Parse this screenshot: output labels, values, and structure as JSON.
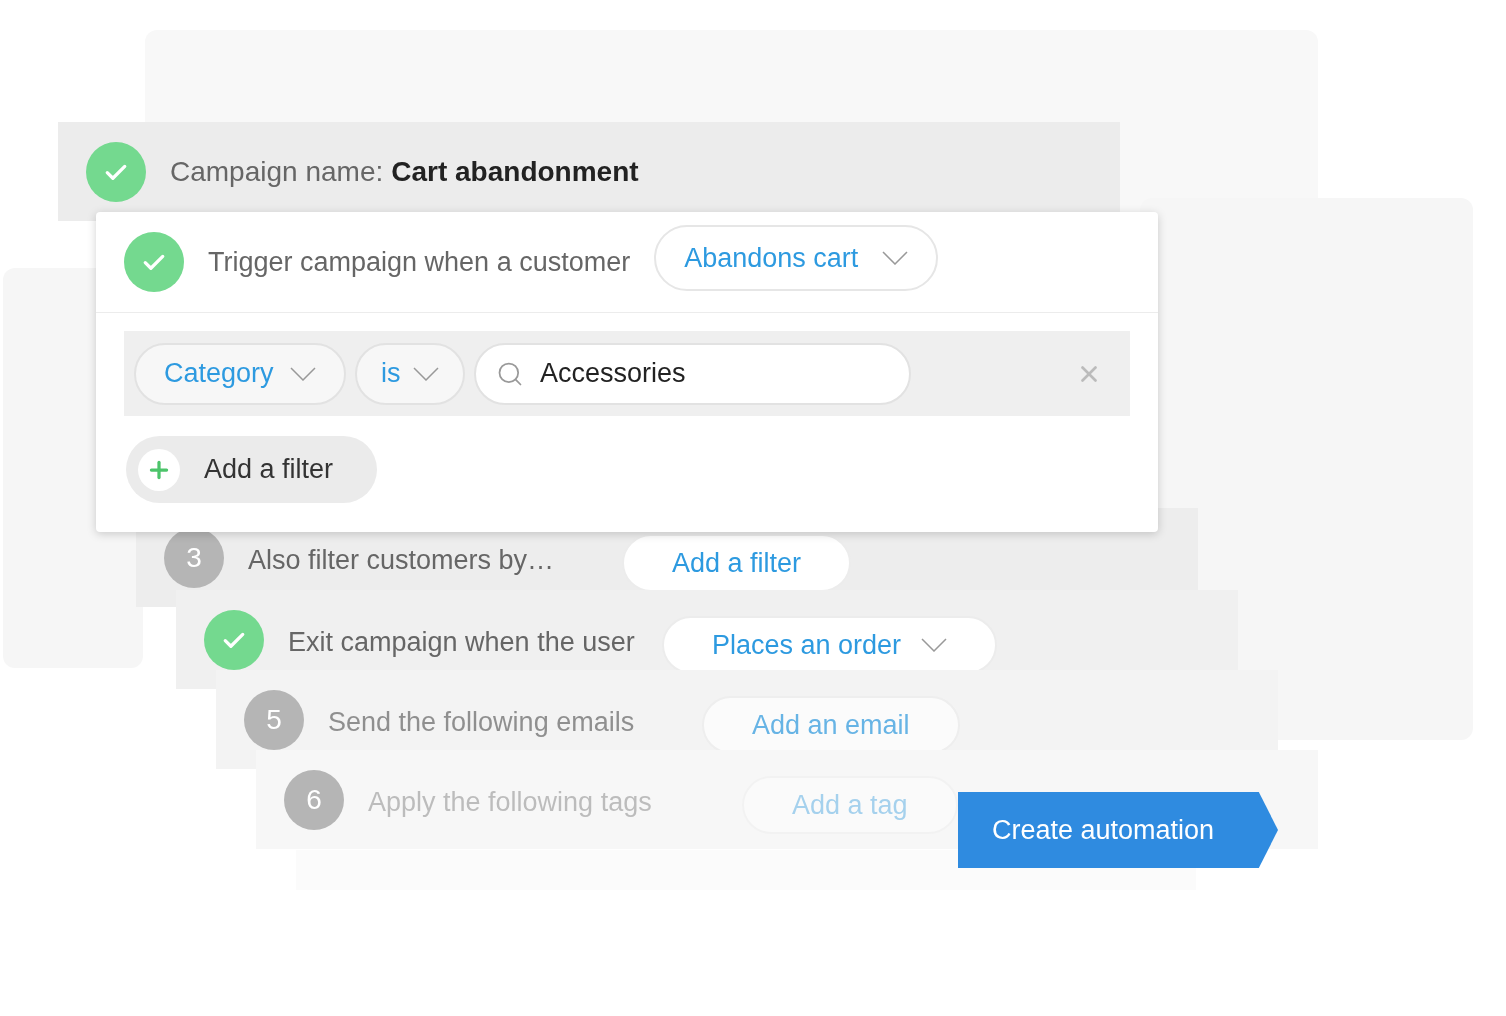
{
  "campaign": {
    "kind": "check",
    "label": "Campaign name:",
    "value": "Cart abandonment"
  },
  "trigger": {
    "kind": "check",
    "label": "Trigger campaign when a customer",
    "dropdown": "Abandons cart"
  },
  "filters": [
    {
      "field": "Category",
      "operator": "is",
      "value": "Accessories"
    }
  ],
  "add_filter": "Add a filter",
  "steps": [
    {
      "kind": "number",
      "number": "3",
      "label": "Also filter customers by…",
      "action": "Add a filter",
      "dropdown": false
    },
    {
      "kind": "check",
      "label": "Exit campaign when the user",
      "action": "Places an order",
      "dropdown": true
    },
    {
      "kind": "number",
      "number": "5",
      "label": "Send the following emails",
      "action": "Add an email",
      "dropdown": false
    },
    {
      "kind": "number",
      "number": "6",
      "label": "Apply the following tags",
      "action": "Add a tag",
      "dropdown": false
    }
  ],
  "create_button": "Create automation"
}
